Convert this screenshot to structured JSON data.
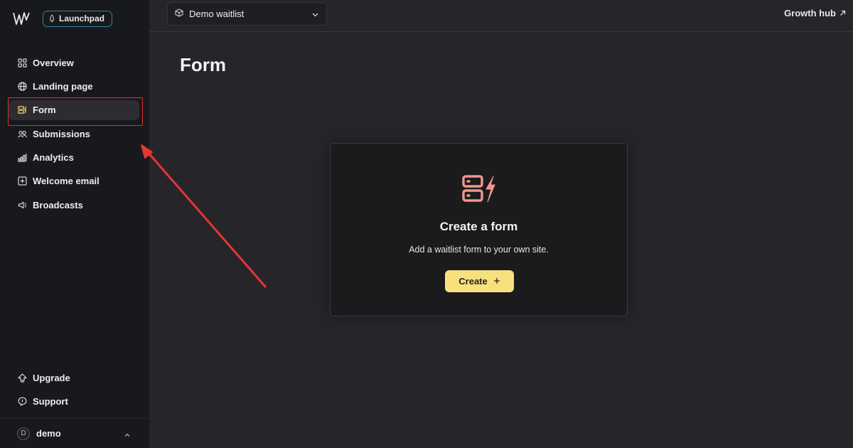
{
  "sidebar": {
    "badge_label": "Launchpad",
    "items": [
      {
        "label": "Overview",
        "icon": "grid-icon"
      },
      {
        "label": "Landing page",
        "icon": "globe-icon"
      },
      {
        "label": "Form",
        "icon": "form-icon",
        "active": true
      },
      {
        "label": "Submissions",
        "icon": "users-icon"
      },
      {
        "label": "Analytics",
        "icon": "bar-chart-icon"
      },
      {
        "label": "Welcome email",
        "icon": "plus-square-icon"
      },
      {
        "label": "Broadcasts",
        "icon": "megaphone-icon"
      }
    ],
    "bottom_items": [
      {
        "label": "Upgrade",
        "icon": "upgrade-arrow-icon"
      },
      {
        "label": "Support",
        "icon": "chat-bubble-icon"
      }
    ],
    "user": {
      "initial": "D",
      "name": "demo"
    }
  },
  "topbar": {
    "project_name": "Demo waitlist",
    "growth_hub_label": "Growth hub"
  },
  "main": {
    "title": "Form",
    "card": {
      "title": "Create a form",
      "description": "Add a waitlist form to your own site.",
      "button_label": "Create"
    }
  },
  "colors": {
    "accent_yellow": "#f7e17d",
    "icon_salmon": "#f0968c",
    "annotation_red": "#e03030",
    "badge_border": "#3e7fa0"
  }
}
